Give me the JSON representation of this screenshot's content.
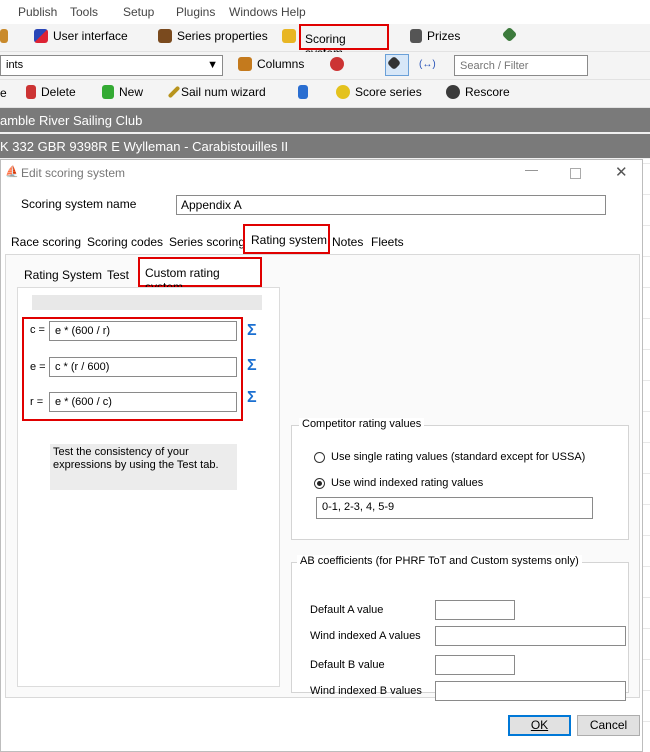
{
  "menu": [
    "Publish",
    "Tools",
    "Setup",
    "Plugins",
    "Windows Help"
  ],
  "toolbar1": {
    "user_interface": "User interface",
    "series_properties": "Series properties",
    "scoring_system": "Scoring system",
    "prizes": "Prizes"
  },
  "toolbar2": {
    "dropdown_value": "ints",
    "columns": "Columns",
    "close_symbol": "×",
    "link_symbol": "(↔)",
    "search_placeholder": "Search / Filter"
  },
  "toolbar3": {
    "lead": "e",
    "delete": "Delete",
    "new": "New",
    "sail_num_wizard": "Sail num wizard",
    "score_series": "Score series",
    "rescore": "Rescore"
  },
  "bands": {
    "club": "amble River Sailing Club",
    "boat": "K 332 GBR 9398R E Wylleman - Carabistouilles II"
  },
  "dialog": {
    "title": "Edit scoring system",
    "name_label": "Scoring system name",
    "name_value": "Appendix A",
    "tabs": [
      "Race scoring",
      "Scoring codes",
      "Series scoring",
      "Rating system",
      "Notes",
      "Fleets"
    ],
    "subtabs": [
      "Rating System",
      "Test",
      "Custom rating system"
    ],
    "formulas": [
      {
        "label": "c =",
        "value": "e * (600 / r)"
      },
      {
        "label": "e =",
        "value": "c * (r / 600)"
      },
      {
        "label": "r =",
        "value": "e * (600 / c)"
      }
    ],
    "sigma": "Σ",
    "hint": "Test the consistency of your expressions by using the Test tab.",
    "competitor_group": {
      "legend": "Competitor rating values",
      "single": "Use single rating values (standard except for USSA)",
      "wind": "Use wind indexed rating values",
      "wind_value": "0-1, 2-3, 4, 5-9",
      "selected": "wind"
    },
    "ab_group": {
      "legend": "AB coefficients (for PHRF ToT and Custom systems only)",
      "default_a": "Default A value",
      "wind_a": "Wind indexed A values",
      "default_b": "Default B value",
      "wind_b": "Wind indexed B values"
    },
    "ok": "OK",
    "cancel": "Cancel"
  },
  "colors": {
    "highlight": "#e00000",
    "band": "#7a7a7a",
    "accent": "#1a6fd1"
  }
}
